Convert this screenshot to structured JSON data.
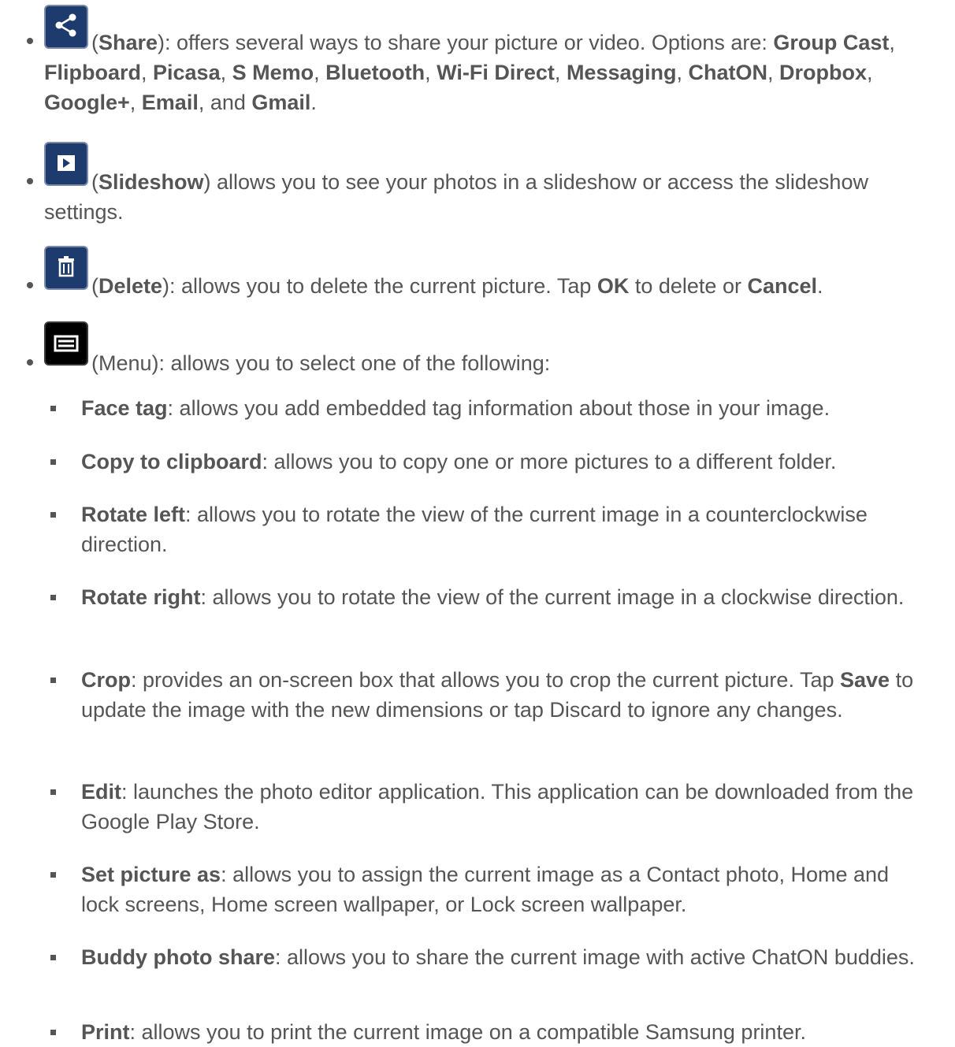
{
  "share": {
    "label": "Share",
    "lead": "(",
    "rest": "): offers several ways to share your picture or video. Options are: ",
    "options": [
      "Group Cast",
      "Flipboard",
      "Picasa",
      "S Memo",
      "Bluetooth",
      "Wi-Fi Direct",
      "Messaging",
      "ChatON",
      "Dropbox",
      "Google+",
      "Email",
      "Gmail"
    ],
    "sep": ", ",
    "and": ", and ",
    "end": "."
  },
  "slideshow": {
    "label": "Slideshow",
    "lead": "(",
    "rest": ") allows you to see your photos in  a slideshow or access the slideshow settings."
  },
  "delete": {
    "label": "Delete",
    "lead": "(",
    "rest": "): allows you to delete the current picture. Tap ",
    "ok": "OK",
    "mid": " to delete or ",
    "cancel": "Cancel",
    "end": "."
  },
  "menu": {
    "text": "(Menu): allows you to select one of the following:",
    "items": [
      {
        "label": "Face tag",
        "text": ": allows you add embedded tag information about those in your image."
      },
      {
        "label": "Copy to clipboard",
        "text": ": allows you to copy one or more pictures to a different folder."
      },
      {
        "label": "Rotate left",
        "text": ": allows you to rotate the view of the current image in a counterclockwise direction."
      },
      {
        "label": "Rotate right",
        "text": ": allows you to rotate the view of the current image in a clockwise direction."
      },
      {
        "label": "Crop",
        "text": ": provides an on-screen box that allows you to crop the current picture. Tap ",
        "save": "Save",
        "text2": " to update the image with the new dimensions or tap Discard to ignore any changes."
      },
      {
        "label": "Edit",
        "text": ": launches the photo editor application. This application can be downloaded from the Google Play Store."
      },
      {
        "label": "Set picture as",
        "text": ": allows you to assign the current image as a Contact photo, Home and lock screens, Home screen wallpaper, or Lock screen wallpaper."
      },
      {
        "label": "Buddy photo share",
        "text": ": allows you to share the current image with active ChatON buddies."
      },
      {
        "label": "Print",
        "text": ": allows you to print the current image on a compatible Samsung printer."
      }
    ]
  },
  "icons": {
    "share": "share-icon",
    "slideshow": "play-icon",
    "delete": "trash-icon",
    "menu": "menu-icon"
  },
  "colors": {
    "text": "#555555",
    "icon_blue": "#1d3b6c",
    "icon_black": "#000000"
  }
}
